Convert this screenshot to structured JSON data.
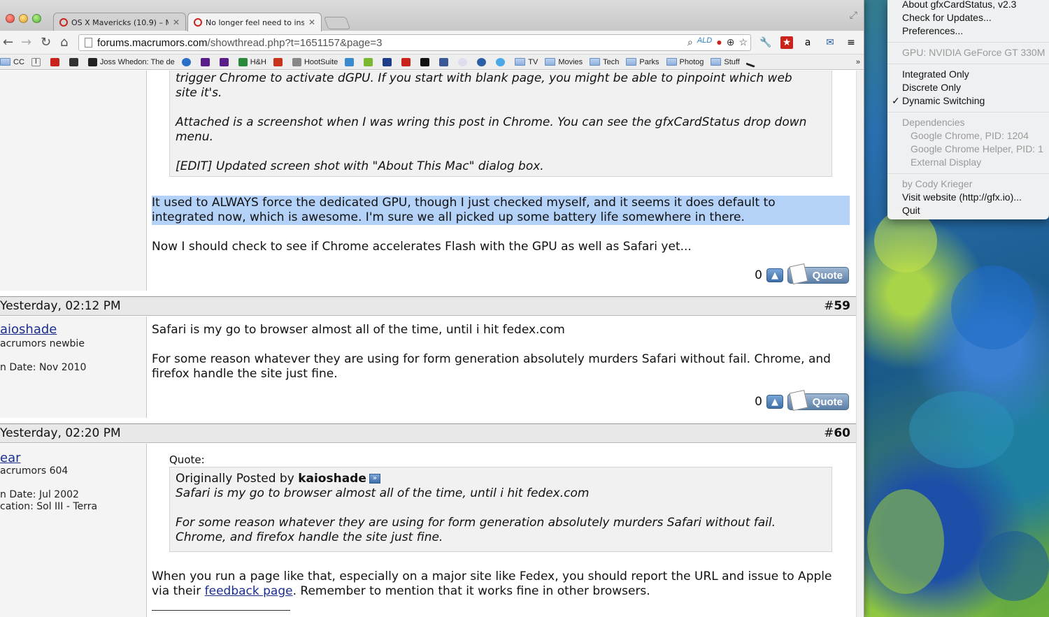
{
  "browser": {
    "tabs": [
      {
        "title": "OS X Mavericks (10.9) – Ma",
        "active": false
      },
      {
        "title": "No longer feel need to inst",
        "active": true
      }
    ],
    "url_domain": "forums.macrumors.com",
    "url_path": "/showthread.php?t=1651157&page=3",
    "bookmarks": [
      "CC",
      "Joss Whedon: The de",
      "H&H",
      "HootSuite",
      "TV",
      "Movies",
      "Tech",
      "Parks",
      "Photog",
      "Stuff"
    ],
    "overflow_label": "»"
  },
  "post58": {
    "quote_lines": [
      "trigger Chrome to activate dGPU. If you start with blank page, you might be able to pinpoint which web",
      "site it's.",
      "Attached is a screenshot when I was wring this post in Chrome. You can see the gfxCardStatus drop down",
      "menu.",
      "[EDIT] Updated screen shot with \"About This Mac\" dialog box."
    ],
    "highlight_line1": "It used to ALWAYS force the dedicated GPU, though I just checked myself, and it seems it does default to",
    "highlight_line2": "integrated now, which is awesome. I'm sure we all picked up some battery life somewhere in there.",
    "body": "Now I should check to see if Chrome accelerates Flash with the GPU as well as Safari yet...",
    "votes": "0",
    "quote_label": "Quote"
  },
  "post59": {
    "date": "Yesterday, 02:12 PM",
    "hash": "#",
    "number": "59",
    "username": "aioshade",
    "rank": "acrumors newbie",
    "join": "n Date: Nov 2010",
    "line1": "Safari is my go to browser almost all of the time, until i hit fedex.com",
    "line2": "For some reason whatever they are using for form generation absolutely murders Safari without fail. Chrome, and",
    "line3": "firefox handle the site just fine.",
    "votes": "0",
    "quote_label": "Quote"
  },
  "post60": {
    "date": "Yesterday, 02:20 PM",
    "hash": "#",
    "number": "60",
    "username": "ear",
    "rank": "acrumors 604",
    "join": "n Date: Jul 2002",
    "location": "cation: Sol III - Terra",
    "quote_label": "Quote:",
    "orig_prefix": "Originally Posted by ",
    "orig_author": "kaioshade",
    "orig_line1": "Safari is my go to browser almost all of the time, until i hit fedex.com",
    "orig_line2": "For some reason whatever they are using for form generation absolutely murders Safari without fail.",
    "orig_line3": "Chrome, and firefox handle the site just fine.",
    "body1": "When you run a page like that, especially on a major site like Fedex, you should report the URL and issue to Apple",
    "body2_pre": "via their ",
    "body2_link": "feedback page",
    "body2_post": ". Remember to mention that it works fine in other browsers."
  },
  "gfx_menu": {
    "about": "About gfxCardStatus, v2.3",
    "updates": "Check for Updates...",
    "prefs": "Preferences...",
    "gpu": "GPU: NVIDIA GeForce GT 330M",
    "integrated": "Integrated Only",
    "discrete": "Discrete Only",
    "dynamic": "Dynamic Switching",
    "checkmark": "✓",
    "deps": "Dependencies",
    "dep1": "Google Chrome, PID: 1204",
    "dep2": "Google Chrome Helper, PID: 1",
    "dep3": "External Display",
    "author": "by Cody Krieger",
    "website": "Visit website (http://gfx.io)...",
    "quit": "Quit"
  }
}
